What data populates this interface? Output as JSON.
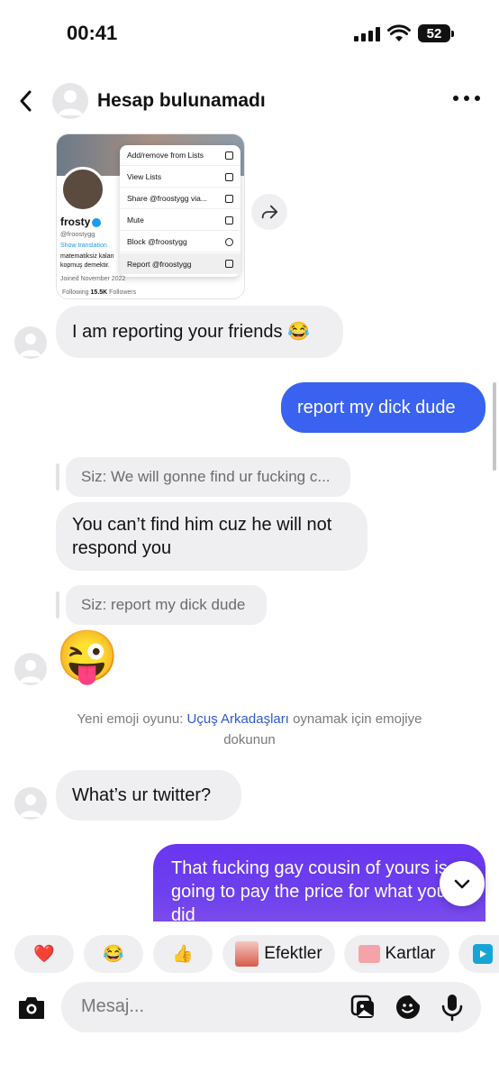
{
  "status_bar": {
    "time": "00:41",
    "battery": "52"
  },
  "header": {
    "title": "Hesap bulunamadı"
  },
  "shared_post": {
    "name": "frosty",
    "handle": "@froostygg",
    "show_translation": "Show translation",
    "bio_lines": [
      "matematiksiz kalan",
      "kopmuş demektir."
    ],
    "joined": "Joined November 2022",
    "following_label": "Following",
    "followers_count": "15.5K",
    "followers_label": "Followers",
    "menu_items": [
      "Add/remove from Lists",
      "View Lists",
      "Share @froostygg via...",
      "Mute",
      "Block @froostygg",
      "Report @froostygg"
    ]
  },
  "messages": {
    "m1": "I am reporting your friends 😂",
    "m2": "report my dick dude",
    "reply1": "Siz: We will gonne find ur fucking c...",
    "m3": "You can’t find him cuz he will not respond you",
    "reply2": "Siz: report my dick dude",
    "m4": "😜",
    "notice_prefix": "Yeni emoji oyunu: ",
    "notice_link": "Uçuş Arkadaşları",
    "notice_suffix": " oynamak için emojiye dokunun",
    "m5": "What’s ur twitter?",
    "m6": "That fucking gay cousin of yours is going to pay the price for what you did"
  },
  "quick_row": {
    "heart": "❤️",
    "laugh": "😂",
    "thumbs": "👍",
    "effects": "Efektler",
    "cards": "Kartlar"
  },
  "composer": {
    "placeholder": "Mesaj..."
  },
  "colors": {
    "outgoing_bubble": "#3a62f0",
    "gradient_start": "#6a36f0",
    "link": "#2e58d6"
  }
}
